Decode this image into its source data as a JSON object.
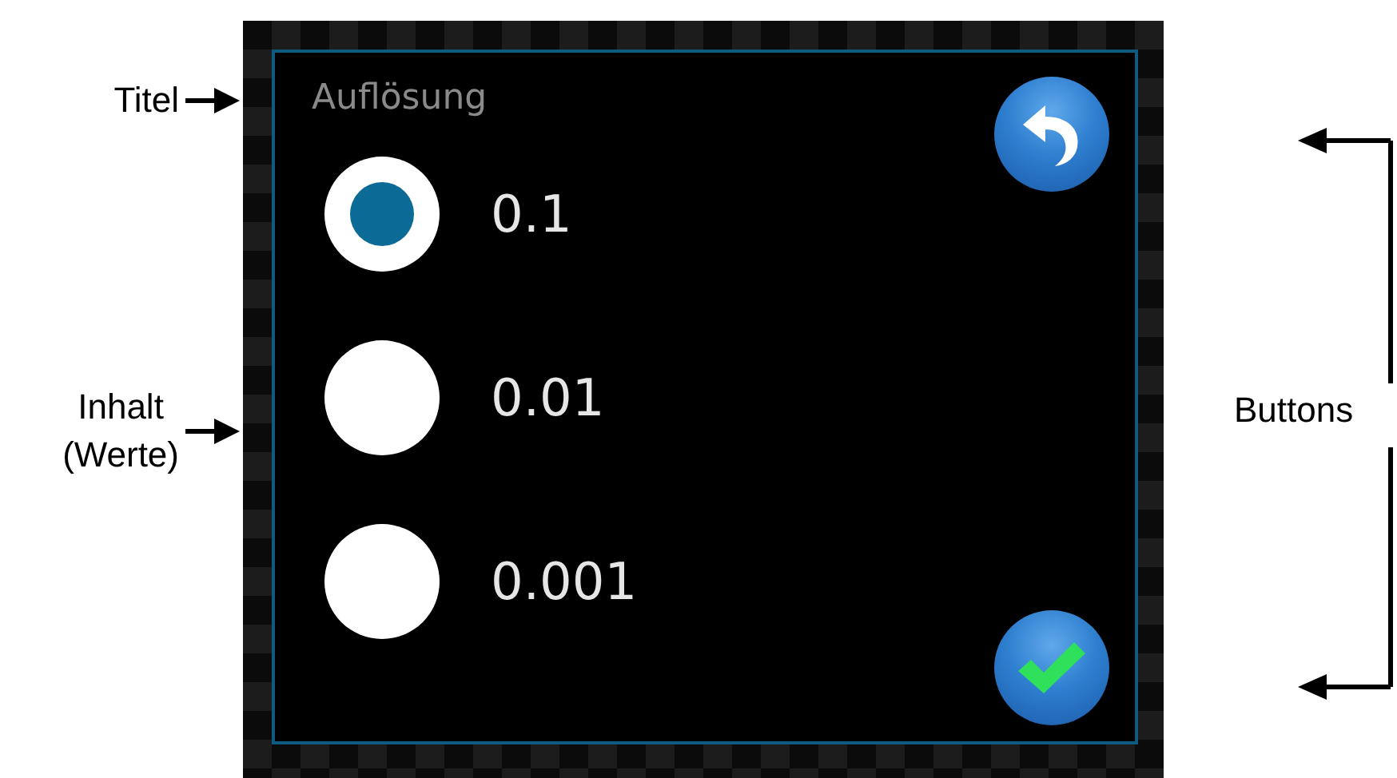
{
  "callouts": [
    {
      "kind": "arrow",
      "lines": [
        "Titel"
      ]
    },
    {
      "kind": "arrow",
      "lines": [
        "Inhalt",
        "(Werte)"
      ]
    },
    {
      "kind": "bracket",
      "lines": [
        "Buttons"
      ]
    }
  ],
  "dialog": {
    "title": "Auflösung",
    "options": [
      {
        "label": "0.1",
        "selected": true
      },
      {
        "label": "0.01",
        "selected": false
      },
      {
        "label": "0.001",
        "selected": false
      }
    ],
    "buttons": [
      {
        "kind": "back"
      },
      {
        "kind": "confirm"
      }
    ]
  }
}
